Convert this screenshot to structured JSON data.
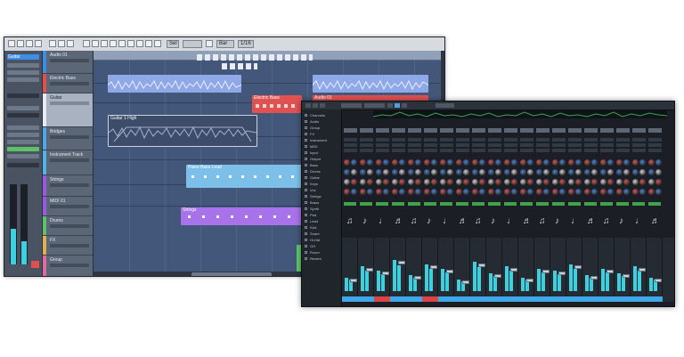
{
  "project": {
    "toolbar": {
      "field1": "Sel",
      "field2": "",
      "field3": "Bar",
      "field4": "1/16"
    },
    "inspector": {
      "title": "Guitar"
    },
    "tracks": [
      {
        "name": "Audio 01",
        "color": "#3e8ee6"
      },
      {
        "name": "Electric Bass",
        "color": "#e24f4f"
      },
      {
        "name": "Guitar",
        "color": "#aab4c2"
      },
      {
        "name": "Bridges",
        "color": "#4fa7e6"
      },
      {
        "name": "Instrument Track",
        "color": "#4fb4e6"
      },
      {
        "name": "Strings",
        "color": "#9a5ae0"
      },
      {
        "name": "MIDI 01",
        "color": "#9a5ae0"
      },
      {
        "name": "Drums",
        "color": "#5fc06a"
      },
      {
        "name": "FX",
        "color": "#e0b04f"
      },
      {
        "name": "Group",
        "color": "#e06aa0"
      }
    ],
    "events": [
      {
        "label": "",
        "color": "#8fa8e8"
      },
      {
        "label": "",
        "color": "#8fa8e8"
      },
      {
        "label": "Electric Bass",
        "color": "#e05252"
      },
      {
        "label": "Audio 01",
        "color": "#e05252"
      },
      {
        "label": "Guitar 1 High",
        "color": "#3d4c68"
      },
      {
        "label": "Piano Bass Lead",
        "color": "#7cc0ea"
      },
      {
        "label": "Strings",
        "color": "#a873ea"
      },
      {
        "label": "",
        "color": "#5dc86a"
      }
    ]
  },
  "mixer": {
    "left_list": [
      "Channels",
      "Audio",
      "Group",
      "FX",
      "Instrument",
      "MIDI",
      "Input",
      "Output",
      "Bass",
      "Drums",
      "Guitar",
      "Keys",
      "Vox",
      "Strings",
      "Brass",
      "Synth",
      "Pad",
      "Lead",
      "Kick",
      "Snare",
      "Hi-Hat",
      "OH",
      "Room",
      "Reverb"
    ],
    "channel_colors": [
      "#3ea8e8",
      "#3ea8e8",
      "#d94545",
      "#3ea8e8",
      "#3ea8e8",
      "#d94545",
      "#3ea8e8",
      "#3ea8e8",
      "#3ea8e8",
      "#3ea8e8",
      "#3ea8e8",
      "#3ea8e8",
      "#3ea8e8",
      "#3ea8e8",
      "#3ea8e8",
      "#3ea8e8",
      "#3ea8e8",
      "#3ea8e8",
      "#3ea8e8",
      "#3ea8e8"
    ],
    "meter_levels": [
      0.3,
      0.55,
      0.45,
      0.7,
      0.35,
      0.6,
      0.5,
      0.25,
      0.65,
      0.4,
      0.55,
      0.3,
      0.5,
      0.45,
      0.6,
      0.35,
      0.5,
      0.4,
      0.55,
      0.3
    ]
  }
}
